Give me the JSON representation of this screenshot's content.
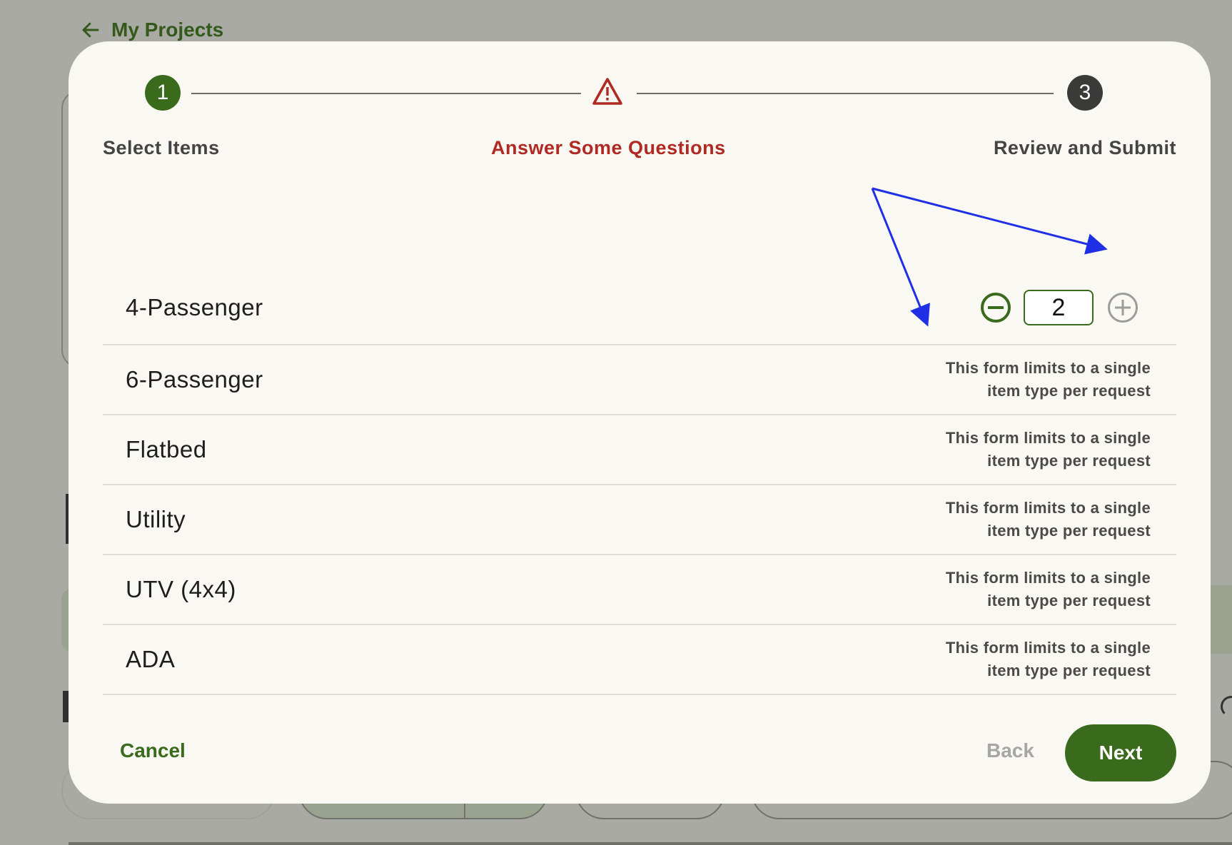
{
  "background": {
    "back_link_label": "My Projects"
  },
  "stepper": {
    "steps": [
      {
        "number": "1",
        "label": "Select Items",
        "state": "complete"
      },
      {
        "number": "",
        "label": "Answer Some Questions",
        "state": "warning"
      },
      {
        "number": "3",
        "label": "Review and Submit",
        "state": "upcoming"
      }
    ]
  },
  "items": [
    {
      "name": "4-Passenger",
      "quantity": "2",
      "note": ""
    },
    {
      "name": "6-Passenger",
      "note": "This form limits to a single item type per request"
    },
    {
      "name": "Flatbed",
      "note": "This form limits to a single item type per request"
    },
    {
      "name": "Utility",
      "note": "This form limits to a single item type per request"
    },
    {
      "name": "UTV (4x4)",
      "note": "This form limits to a single item type per request"
    },
    {
      "name": "ADA",
      "note": "This form limits to a single item type per request"
    }
  ],
  "footer": {
    "cancel_label": "Cancel",
    "back_label": "Back",
    "next_label": "Next"
  },
  "colors": {
    "primary_green": "#3a6b1c",
    "error_red": "#b02a23",
    "annotation_blue": "#1f2fe6"
  }
}
